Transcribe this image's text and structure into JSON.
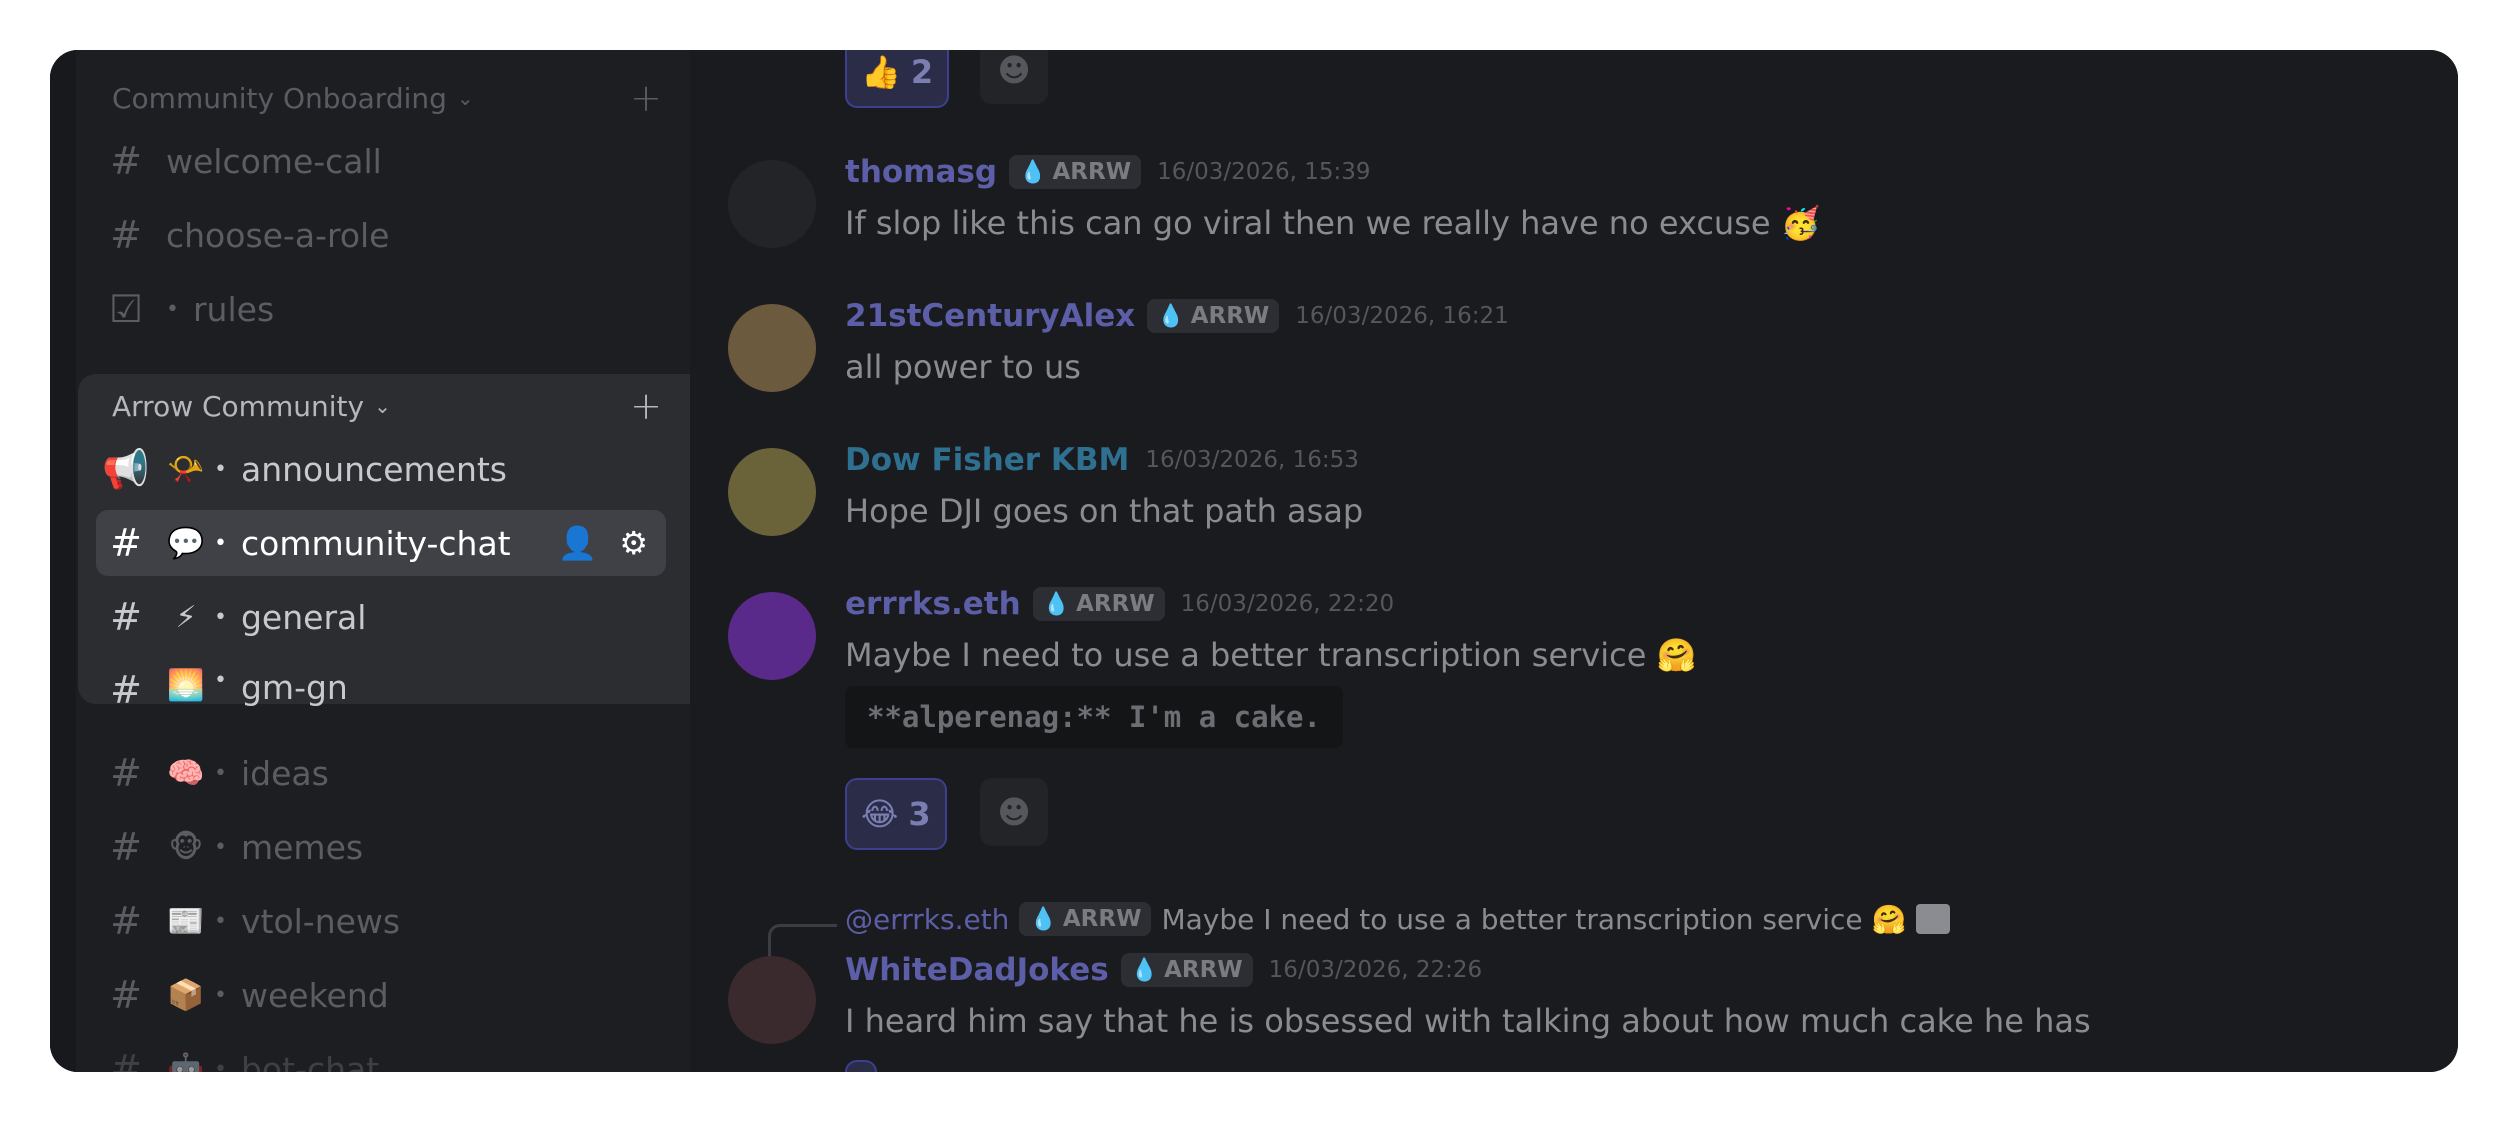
{
  "sidebar": {
    "categories": [
      {
        "name": "Community Onboarding"
      },
      {
        "name": "Arrow Community"
      }
    ],
    "onboarding_channels": [
      {
        "icon": "#",
        "emoji": "",
        "name": "welcome-call"
      },
      {
        "icon": "#",
        "emoji": "",
        "name": "choose-a-role"
      },
      {
        "icon": "☑",
        "emoji": "",
        "name": "rules"
      }
    ],
    "community_channels": [
      {
        "icon": "📢",
        "emoji": "📯",
        "name": "announcements"
      },
      {
        "icon": "#",
        "emoji": "💬",
        "name": "community-chat"
      },
      {
        "icon": "#",
        "emoji": "⚡",
        "name": "general"
      },
      {
        "icon": "#",
        "emoji": "🌅",
        "name": "gm-gn"
      },
      {
        "icon": "#",
        "emoji": "🧠",
        "name": "ideas"
      },
      {
        "icon": "#",
        "emoji": "🐵",
        "name": "memes"
      },
      {
        "icon": "#",
        "emoji": "📰",
        "name": "vtol-news"
      },
      {
        "icon": "#",
        "emoji": "📦",
        "name": "weekend"
      },
      {
        "icon": "#",
        "emoji": "🤖",
        "name": "bot-chat"
      }
    ],
    "active_channel": "community-chat"
  },
  "chat": {
    "top_reaction": {
      "emoji": "👍",
      "count": "2"
    },
    "messages": [
      {
        "user": "thomasg",
        "user_color": "#5c5fa8",
        "badge": "ARRW",
        "time": "16/03/2026, 15:39",
        "text": "If slop like this can go viral then we really have no excuse 🥳"
      },
      {
        "user": "21stCenturyAlex",
        "user_color": "#5c5fa8",
        "badge": "ARRW",
        "time": "16/03/2026, 16:21",
        "text": "all power to us"
      },
      {
        "user": "Dow Fisher KBM",
        "user_color": "#2f6f8f",
        "badge": "",
        "time": "16/03/2026, 16:53",
        "text": "Hope DJI goes on that path asap"
      },
      {
        "user": "errrks.eth",
        "user_color": "#5c5fa8",
        "badge": "ARRW",
        "time": "16/03/2026, 22:20",
        "text": "Maybe I need to use a better transcription service 🤗",
        "code": "**alperenag:** I'm a cake.",
        "reaction": {
          "emoji": "😂",
          "count": "3"
        }
      },
      {
        "user": "WhiteDadJokes",
        "user_color": "#5c5fa8",
        "badge": "ARRW",
        "time": "16/03/2026, 22:26",
        "text": "I heard him say that he is obsessed with talking about how much cake he has",
        "reply": {
          "user": "@errrks.eth",
          "badge": "ARRW",
          "text": "Maybe I need to use a better transcription service 🤗"
        }
      }
    ]
  }
}
